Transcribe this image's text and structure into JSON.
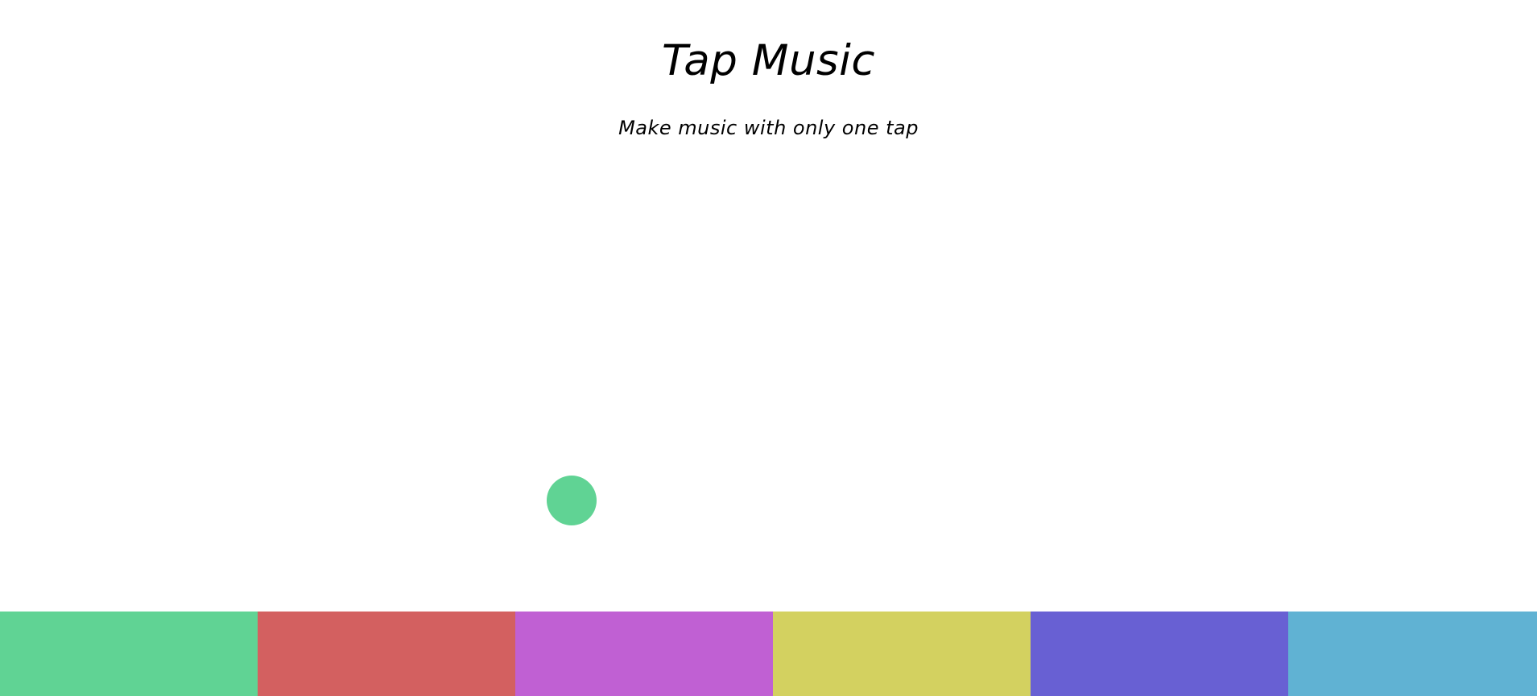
{
  "header": {
    "title": "Tap Music",
    "subtitle": "Make music with only one tap"
  },
  "visual": {
    "ball_color": "#60d394"
  },
  "pads": [
    {
      "name": "pad-1",
      "color": "#60d394"
    },
    {
      "name": "pad-2",
      "color": "#d36060"
    },
    {
      "name": "pad-3",
      "color": "#c060d3"
    },
    {
      "name": "pad-4",
      "color": "#d3d160"
    },
    {
      "name": "pad-5",
      "color": "#6860d3"
    },
    {
      "name": "pad-6",
      "color": "#60b2d3"
    }
  ]
}
